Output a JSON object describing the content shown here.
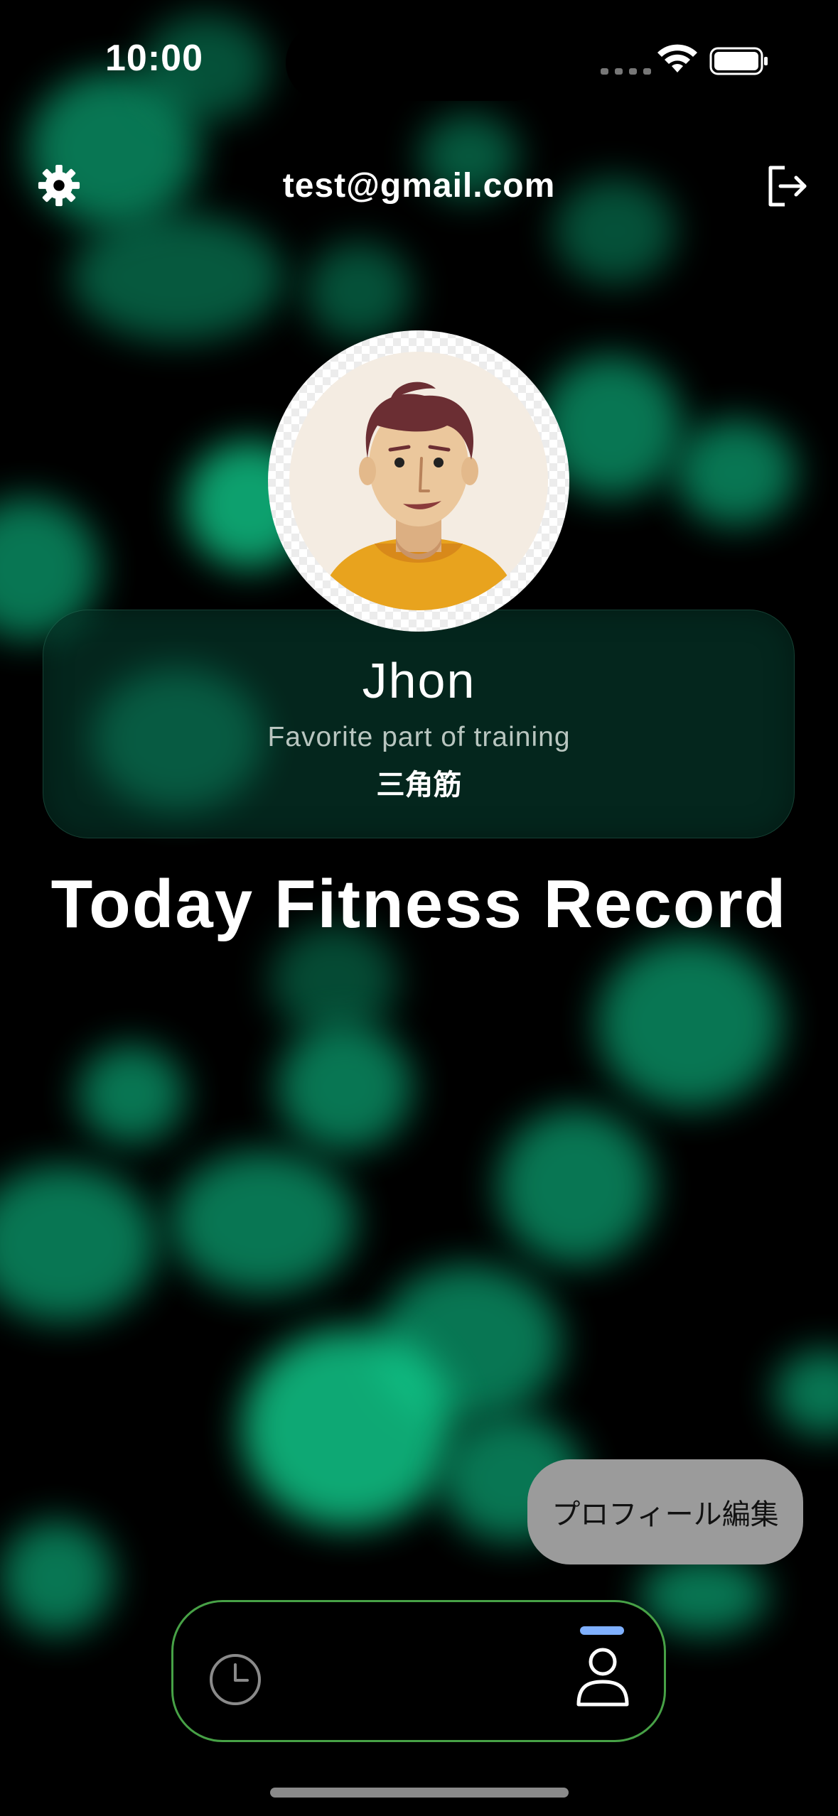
{
  "status_bar": {
    "time": "10:00",
    "icons": [
      "cellular-icon",
      "wifi-icon",
      "battery-icon"
    ]
  },
  "header": {
    "email": "test@gmail.com",
    "left_icon": "gear-icon",
    "right_icon": "logout-icon"
  },
  "profile": {
    "name": "Jhon",
    "favorite_label": "Favorite part of training",
    "favorite_value": "三角筋",
    "avatar": "avatar-illustration"
  },
  "section": {
    "title": "Today Fitness Record"
  },
  "edit_button": {
    "label": "プロフィール編集"
  },
  "tab_bar": {
    "tabs": [
      {
        "icon": "clock-icon",
        "selected": false
      },
      {
        "icon": "person-icon",
        "selected": true
      }
    ]
  },
  "colors": {
    "background": "#000000",
    "blob_green": "#0a9468",
    "tab_border": "#47a146",
    "selected_indicator": "#7fb0ff",
    "edit_button_bg": "#9b9b9b"
  }
}
